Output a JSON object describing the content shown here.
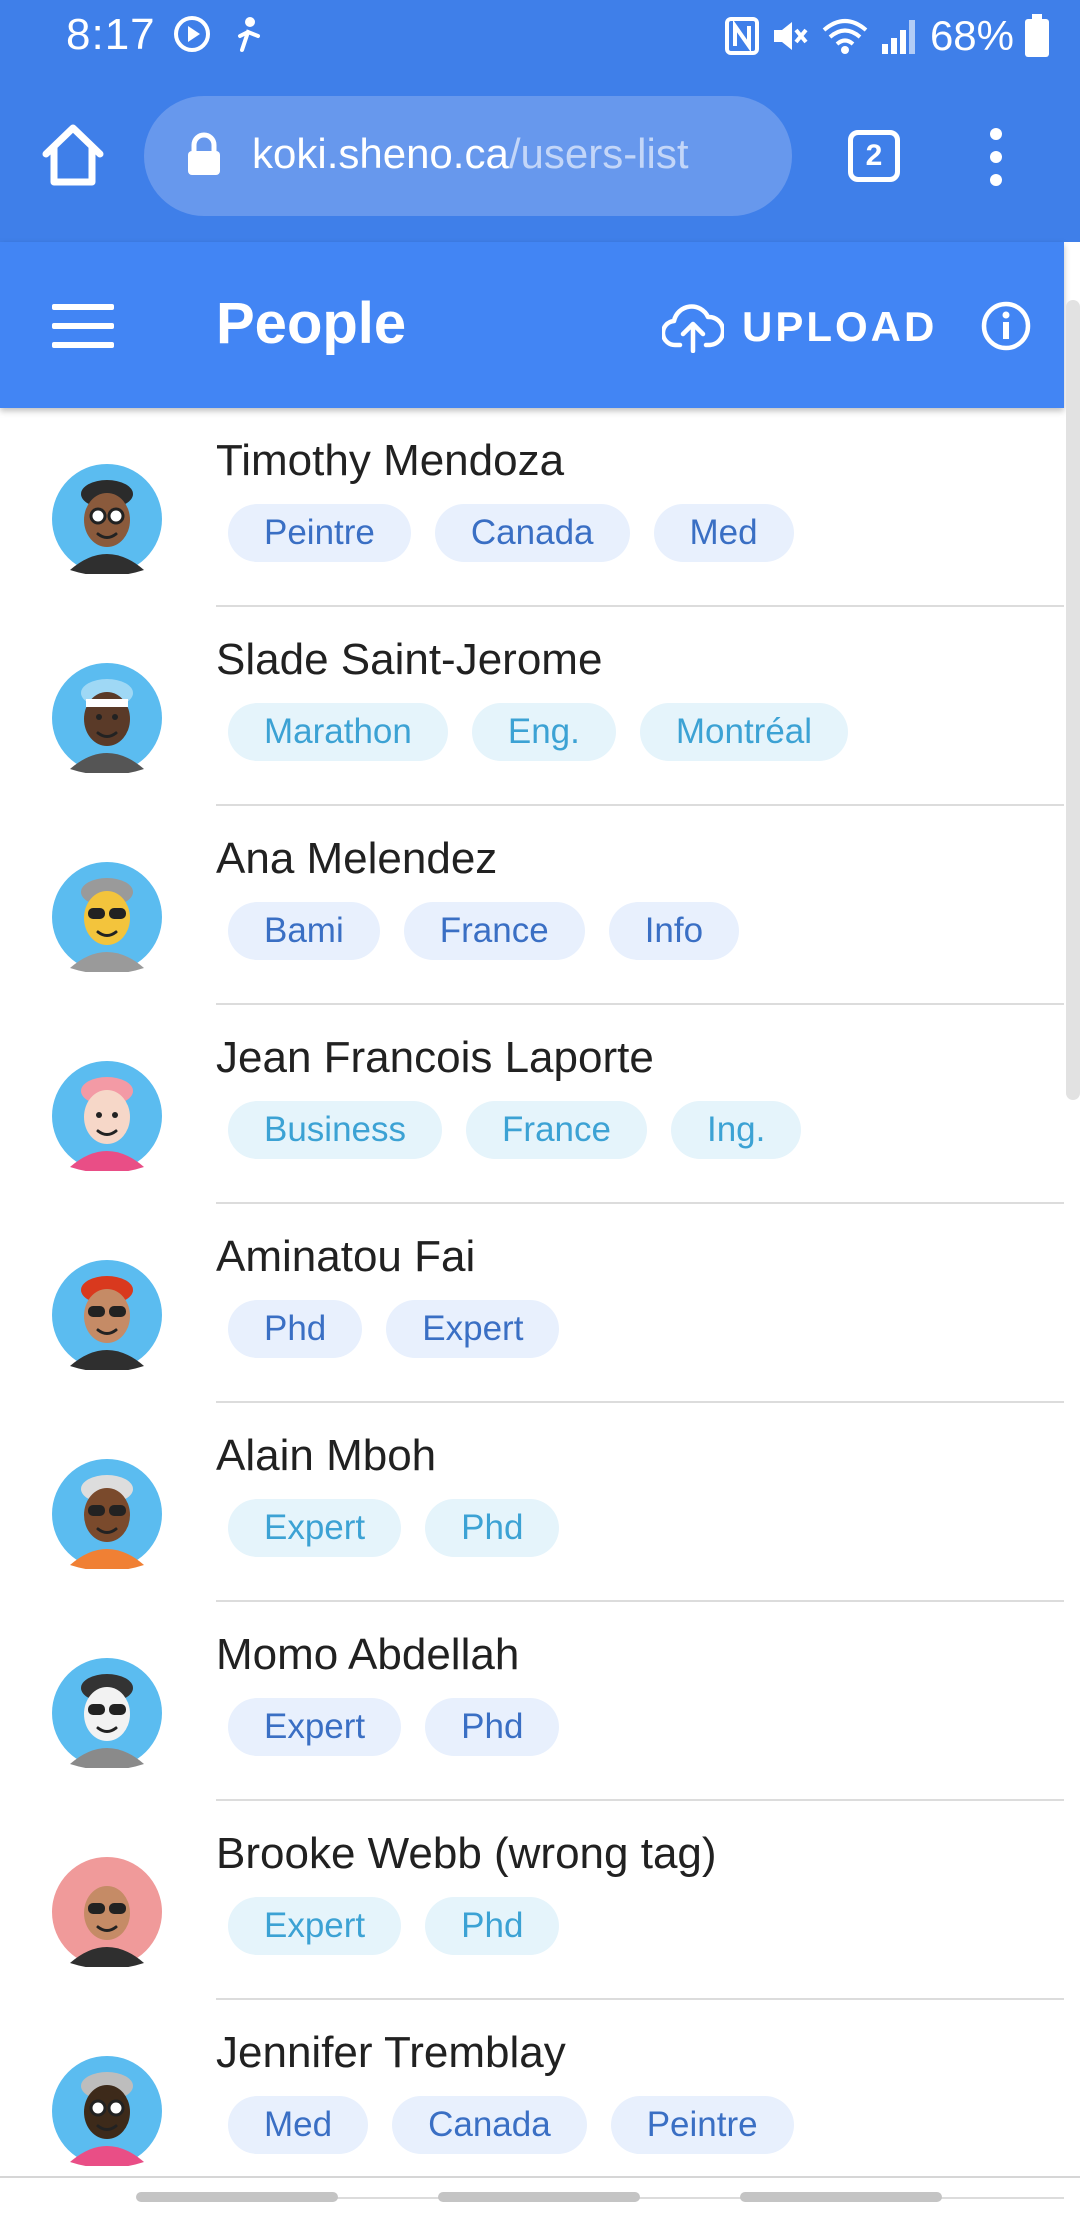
{
  "status_bar": {
    "time": "8:17",
    "battery": "68%"
  },
  "browser": {
    "url_host": "koki.sheno.ca",
    "url_path": "/users-list",
    "tab_count": "2"
  },
  "toolbar": {
    "title": "People",
    "upload_label": "UPLOAD"
  },
  "colors": {
    "status_bar": "#3f7fe9",
    "toolbar": "#4285f4",
    "chip_bg": "#e8f0fd",
    "chip_text": "#3a6fc4",
    "chip_alt_bg": "#e5f4fb",
    "chip_alt_text": "#3ca2d4"
  },
  "people": [
    {
      "name": "Timothy Mendoza",
      "tags": [
        "Peintre",
        "Canada",
        "Med"
      ],
      "avatar": "man-glasses-beard-avatar"
    },
    {
      "name": "Slade Saint-Jerome",
      "tags": [
        "Marathon",
        "Eng.",
        "Montréal"
      ],
      "avatar": "man-headband-avatar"
    },
    {
      "name": "Ana Melendez",
      "tags": [
        "Bami",
        "France",
        "Info"
      ],
      "avatar": "woman-hijab-sunglasses-avatar"
    },
    {
      "name": "Jean Francois Laporte",
      "tags": [
        "Business",
        "France",
        "Ing."
      ],
      "avatar": "pink-hair-winking-avatar"
    },
    {
      "name": "Aminatou Fai",
      "tags": [
        "Phd",
        "Expert"
      ],
      "avatar": "red-hair-sunglasses-avatar"
    },
    {
      "name": "Alain Mboh",
      "tags": [
        "Expert",
        "Phd"
      ],
      "avatar": "beard-sunglasses-orange-avatar"
    },
    {
      "name": "Momo Abdellah",
      "tags": [
        "Expert",
        "Phd"
      ],
      "avatar": "hat-sunglasses-avatar"
    },
    {
      "name": "Brooke Webb (wrong tag)",
      "tags": [
        "Expert",
        "Phd"
      ],
      "avatar": "pink-hair-sunglasses-avatar"
    },
    {
      "name": "Jennifer Tremblay",
      "tags": [
        "Med",
        "Canada",
        "Peintre"
      ],
      "avatar": "gray-hair-goggles-avatar"
    }
  ]
}
